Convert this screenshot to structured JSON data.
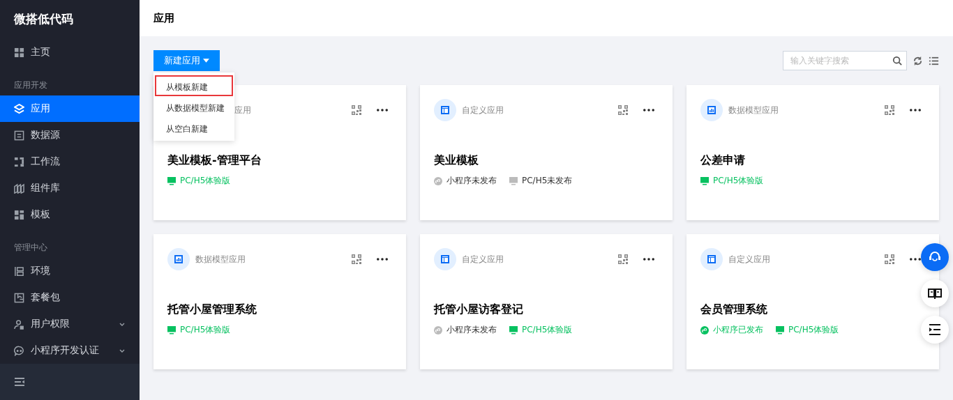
{
  "sidebar": {
    "brand": "微搭低代码",
    "groups": [
      {
        "items": [
          {
            "label": "主页",
            "selected": false
          }
        ]
      },
      {
        "title": "应用开发",
        "items": [
          {
            "label": "应用",
            "selected": true
          },
          {
            "label": "数据源",
            "selected": false
          },
          {
            "label": "工作流",
            "selected": false
          },
          {
            "label": "组件库",
            "selected": false
          },
          {
            "label": "模板",
            "selected": false
          }
        ]
      },
      {
        "title": "管理中心",
        "items": [
          {
            "label": "环境",
            "selected": false
          },
          {
            "label": "套餐包",
            "selected": false
          },
          {
            "label": "用户权限",
            "selected": false,
            "expanded": false
          },
          {
            "label": "小程序开发认证",
            "selected": false,
            "expanded": false
          }
        ]
      }
    ]
  },
  "header": {
    "title": "应用"
  },
  "toolbar": {
    "new_button": "新建应用",
    "search": {
      "placeholder": "输入关键字搜索"
    }
  },
  "new_menu": [
    {
      "label": "从模板新建",
      "selected": true
    },
    {
      "label": "从数据模型新建",
      "selected": false
    },
    {
      "label": "从空白新建",
      "selected": false
    }
  ],
  "cards": [
    {
      "type": "应用",
      "kind": "covered",
      "name": "美业模板-管理平台",
      "tags": [
        {
          "kind": "pc",
          "label": "PC/H5体验版",
          "published": true
        }
      ]
    },
    {
      "type": "自定义应用",
      "kind": "custom",
      "name": "美业模板",
      "tags": [
        {
          "kind": "miniprogram",
          "label": "小程序未发布",
          "published": false
        },
        {
          "kind": "pc",
          "label": "PC/H5未发布",
          "published": false
        }
      ]
    },
    {
      "type": "数据模型应用",
      "kind": "model",
      "name": "公差申请",
      "tags": [
        {
          "kind": "pc",
          "label": "PC/H5体验版",
          "published": true
        }
      ]
    },
    {
      "type": "数据模型应用",
      "kind": "model",
      "name": "托管小屋管理系统",
      "tags": [
        {
          "kind": "pc",
          "label": "PC/H5体验版",
          "published": true
        }
      ]
    },
    {
      "type": "自定义应用",
      "kind": "custom",
      "name": "托管小屋访客登记",
      "tags": [
        {
          "kind": "miniprogram",
          "label": "小程序未发布",
          "published": false
        },
        {
          "kind": "pc",
          "label": "PC/H5体验版",
          "published": true
        }
      ]
    },
    {
      "type": "自定义应用",
      "kind": "custom",
      "name": "会员管理系统",
      "tags": [
        {
          "kind": "miniprogram",
          "label": "小程序已发布",
          "published": true
        },
        {
          "kind": "pc",
          "label": "PC/H5体验版",
          "published": true
        }
      ]
    }
  ]
}
